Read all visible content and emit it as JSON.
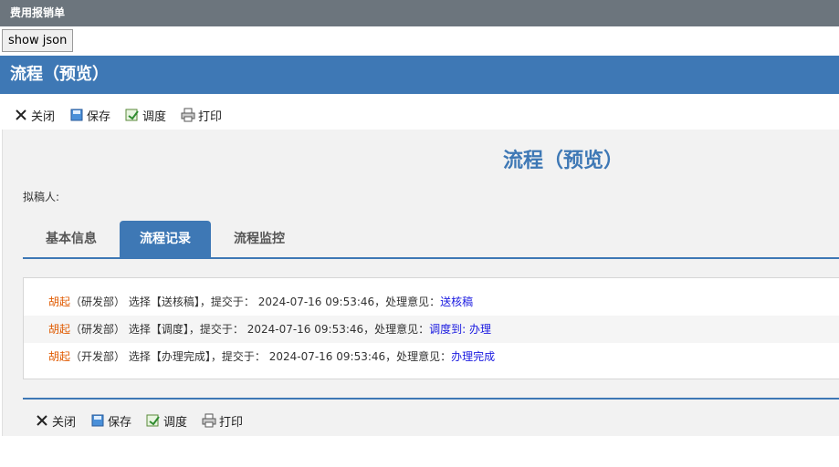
{
  "window": {
    "title": "费用报销单"
  },
  "show_json_label": "show json",
  "flow_header": {
    "title": "流程（预览）"
  },
  "toolbar": {
    "close": "关闭",
    "save": "保存",
    "dispatch": "调度",
    "print": "打印"
  },
  "main": {
    "title": "流程（预览）",
    "drafter_label": "拟稿人:"
  },
  "tabs": [
    {
      "label": "基本信息"
    },
    {
      "label": "流程记录"
    },
    {
      "label": "流程监控"
    }
  ],
  "records": [
    {
      "name": "胡起",
      "dept": "（研发部）",
      "action": "选择【送核稿】，提交于：",
      "time": "2024-07-16 09:53:46",
      "opinion_label": "，处理意见：",
      "opinion": "送核稿"
    },
    {
      "name": "胡起",
      "dept": "（研发部）",
      "action": "选择【调度】，提交于：",
      "time": "2024-07-16 09:53:46",
      "opinion_label": "，处理意见：",
      "opinion": "调度到: 办理"
    },
    {
      "name": "胡起",
      "dept": "（开发部）",
      "action": "选择【办理完成】，提交于：",
      "time": "2024-07-16 09:53:46",
      "opinion_label": "，处理意见：",
      "opinion": "办理完成"
    }
  ],
  "colors": {
    "accent": "#3e78b5",
    "name": "#e05a00",
    "link": "#1a1ae0",
    "titlebar": "#6c757d"
  }
}
